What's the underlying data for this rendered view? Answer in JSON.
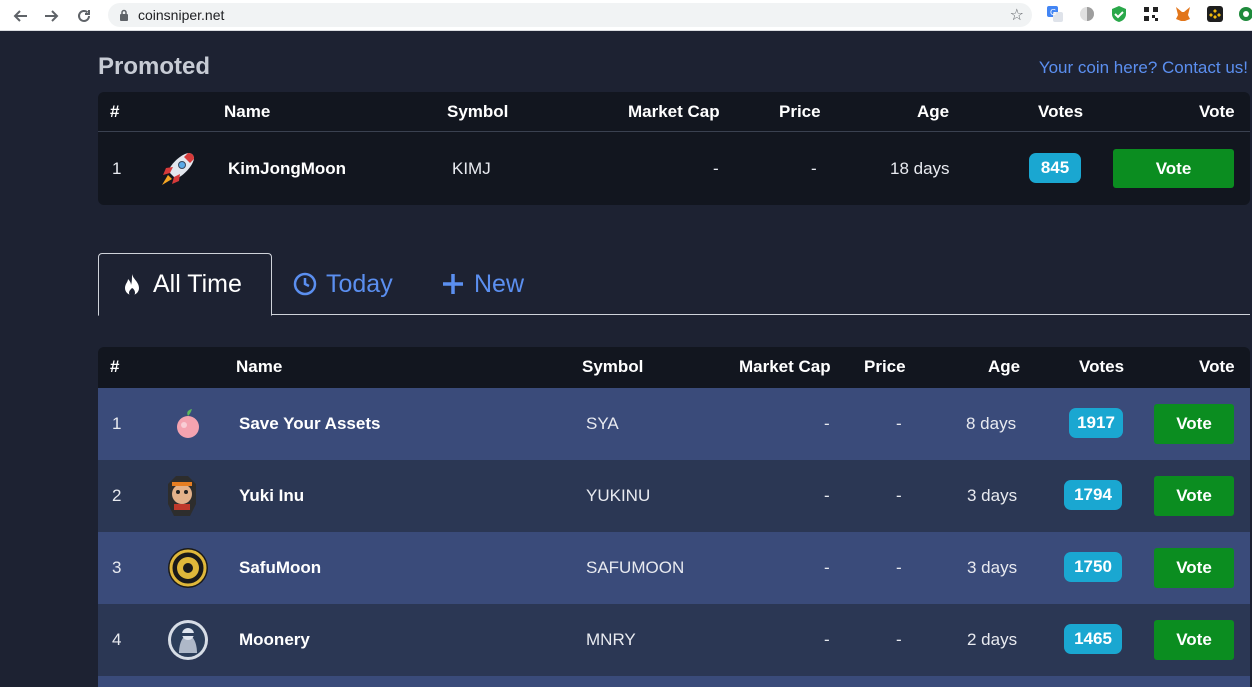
{
  "browser": {
    "url": "coinsniper.net"
  },
  "promoted": {
    "title": "Promoted",
    "contact_link": "Your coin here? Contact us!",
    "headers": [
      "#",
      "Name",
      "Symbol",
      "Market Cap",
      "Price",
      "Age",
      "Votes",
      "Vote"
    ],
    "rows": [
      {
        "rank": "1",
        "name": "KimJongMoon",
        "symbol": "KIMJ",
        "market_cap": "-",
        "price": "-",
        "age": "18 days",
        "votes": "845",
        "vote_label": "Vote"
      }
    ]
  },
  "tabs": [
    {
      "label": "All Time",
      "icon": "fire-icon"
    },
    {
      "label": "Today",
      "icon": "clock-icon"
    },
    {
      "label": "New",
      "icon": "plus-icon"
    }
  ],
  "ranking": {
    "headers": [
      "#",
      "Name",
      "Symbol",
      "Market Cap",
      "Price",
      "Age",
      "Votes",
      "Vote"
    ],
    "rows": [
      {
        "rank": "1",
        "name": "Save Your Assets",
        "symbol": "SYA",
        "market_cap": "-",
        "price": "-",
        "age": "8 days",
        "votes": "1917",
        "vote_label": "Vote"
      },
      {
        "rank": "2",
        "name": "Yuki Inu",
        "symbol": "YUKINU",
        "market_cap": "-",
        "price": "-",
        "age": "3 days",
        "votes": "1794",
        "vote_label": "Vote"
      },
      {
        "rank": "3",
        "name": "SafuMoon",
        "symbol": "SAFUMOON",
        "market_cap": "-",
        "price": "-",
        "age": "3 days",
        "votes": "1750",
        "vote_label": "Vote"
      },
      {
        "rank": "4",
        "name": "Moonery",
        "symbol": "MNRY",
        "market_cap": "-",
        "price": "-",
        "age": "2 days",
        "votes": "1465",
        "vote_label": "Vote"
      }
    ]
  },
  "colors": {
    "page_bg": "#1d2232",
    "table_bg": "#12161f",
    "row_odd": "#3a4b7a",
    "row_even": "#2b3754",
    "badge": "#1aa7d1",
    "vote_button": "#0b8d20",
    "link": "#5b8ff0"
  }
}
